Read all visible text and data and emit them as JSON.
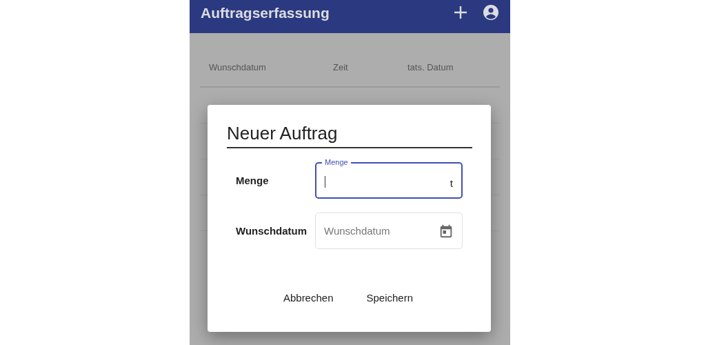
{
  "app_bar": {
    "title": "Auftragserfassung"
  },
  "table": {
    "columns": [
      "Wunschdatum",
      "Zeit",
      "tats. Datum"
    ]
  },
  "dialog": {
    "title": "Neuer Auftrag",
    "fields": [
      {
        "kind": "text",
        "label": "Menge",
        "floating_label": "Menge",
        "suffix": "t",
        "focused": true
      },
      {
        "kind": "date",
        "label": "Wunschdatum",
        "placeholder": "Wunschdatum",
        "focused": false
      }
    ],
    "buttons": [
      "Abbrechen",
      "Speichern"
    ]
  }
}
